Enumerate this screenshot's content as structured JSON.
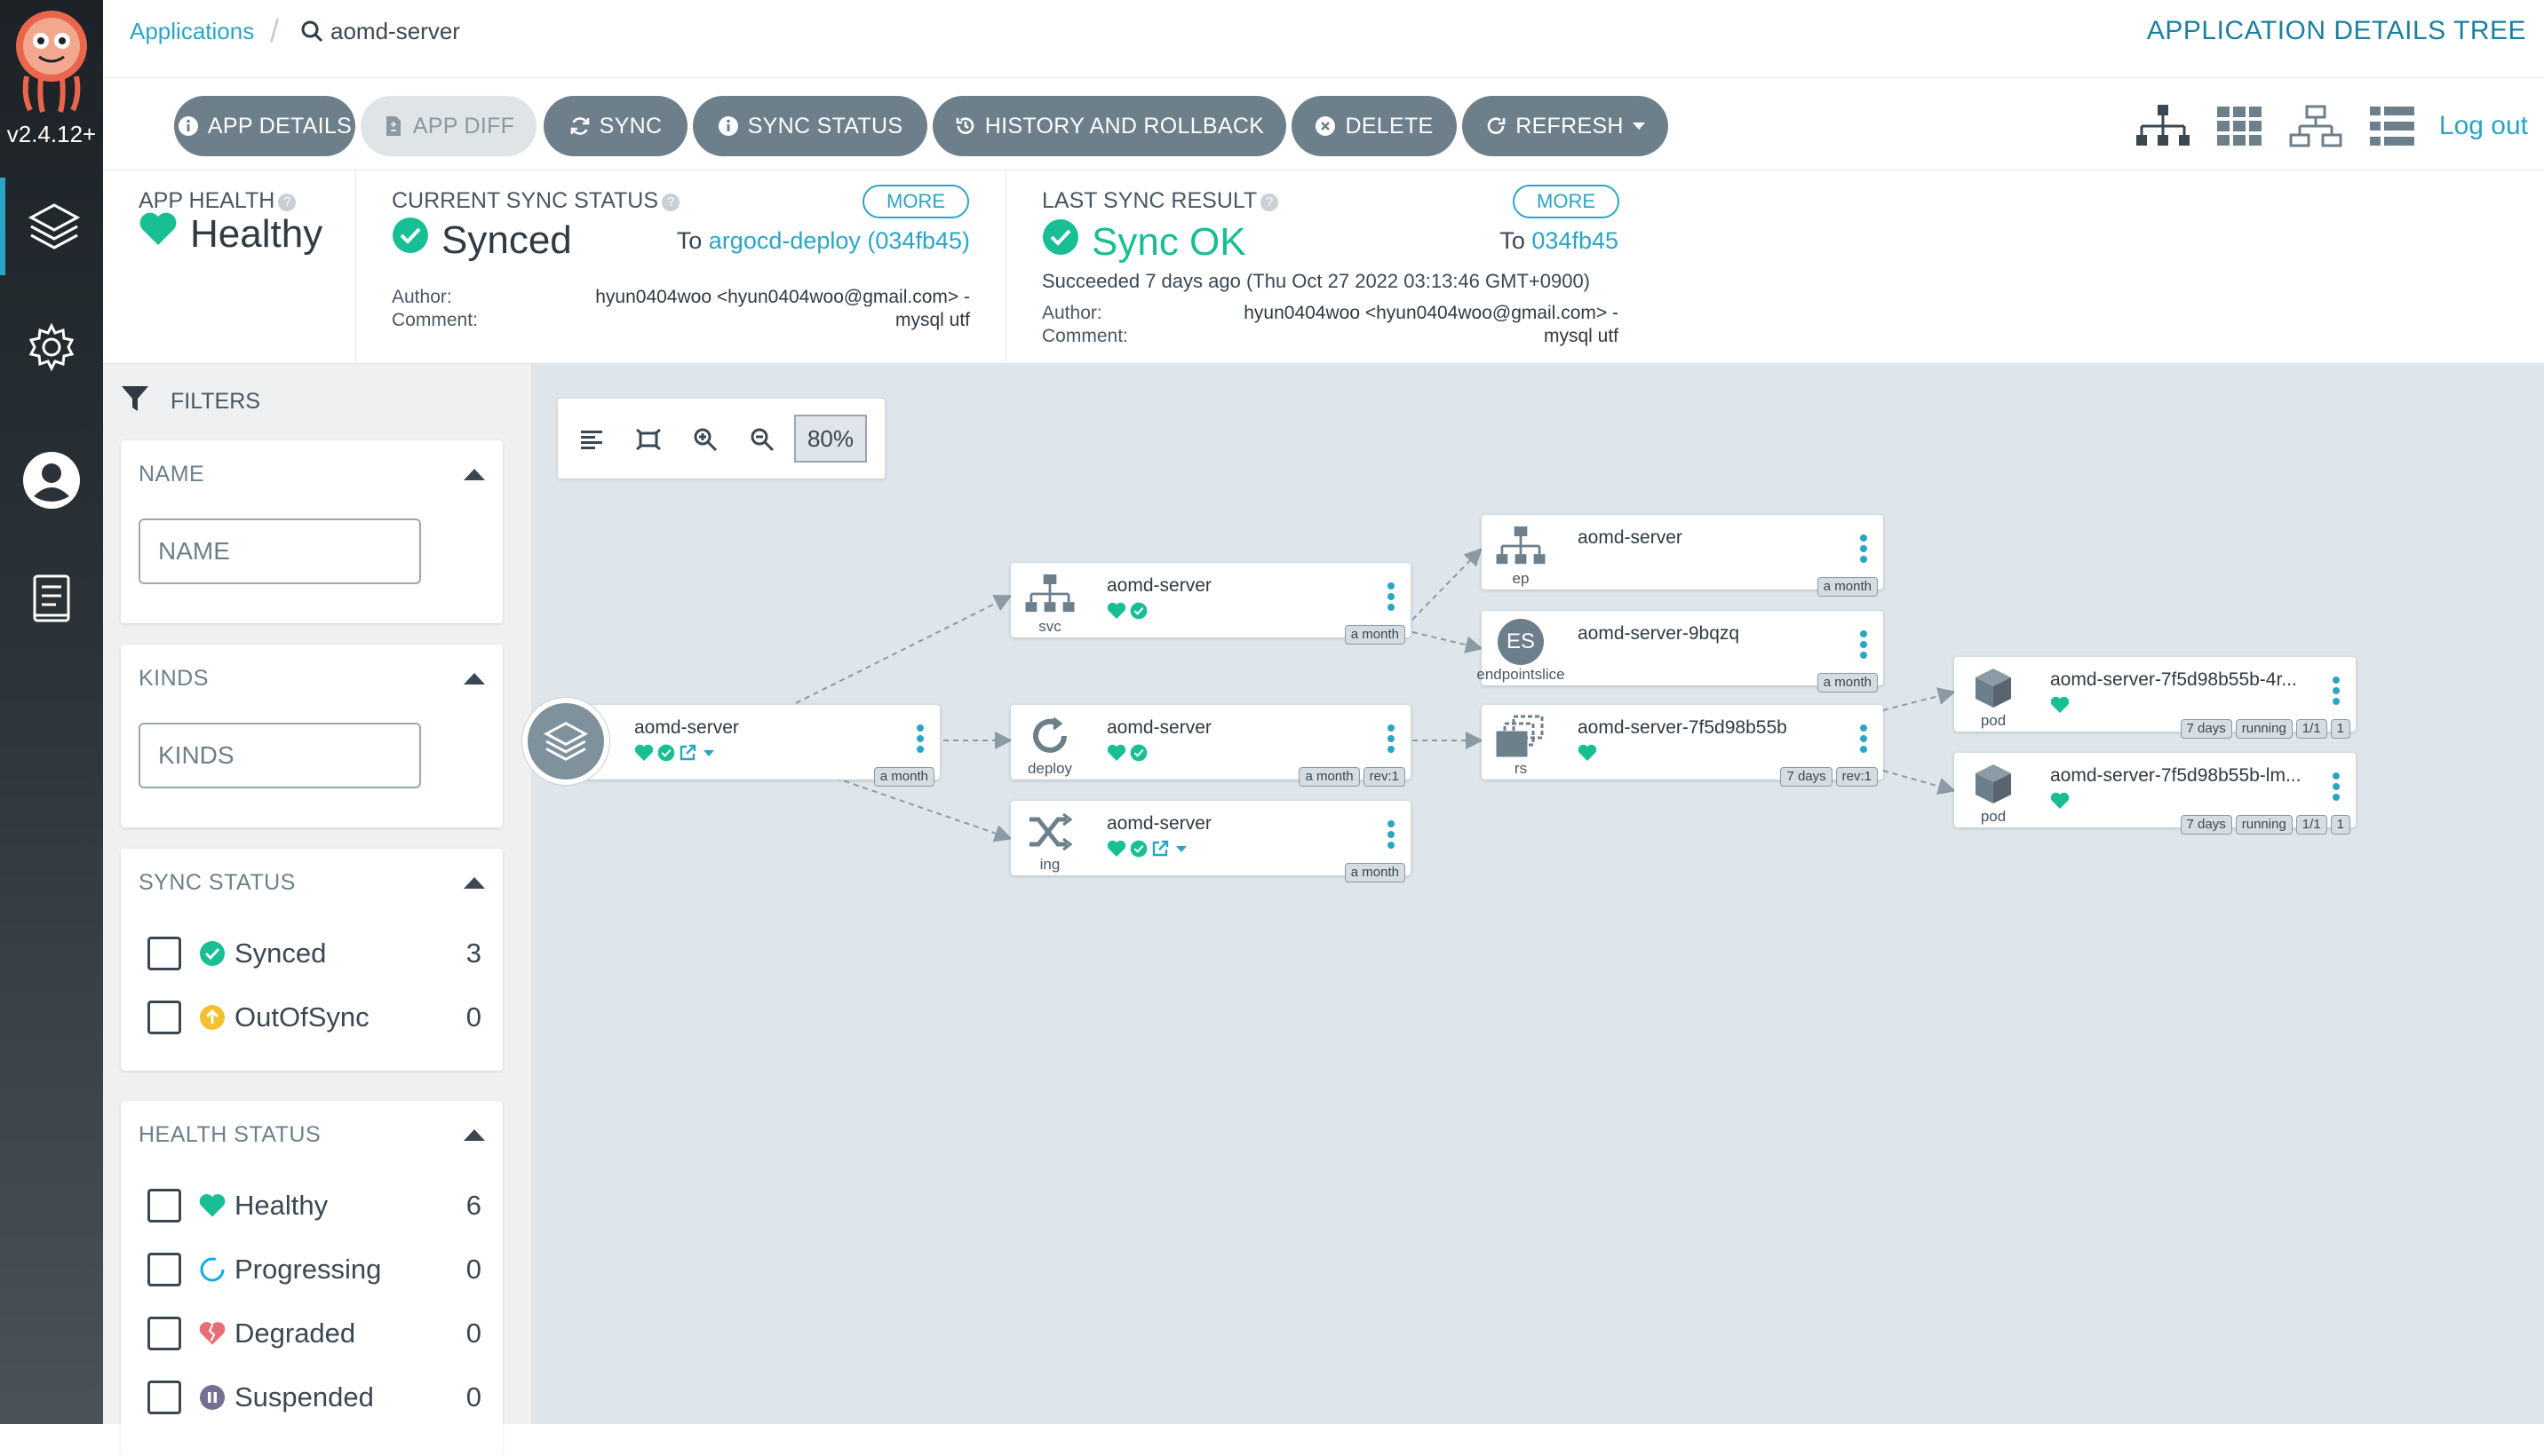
{
  "nav": {
    "version": "v2.4.12+",
    "items": [
      "layers-icon",
      "gear-icon",
      "user-icon",
      "docs-icon"
    ]
  },
  "breadcrumb": {
    "root": "Applications",
    "current": "aomd-server"
  },
  "page_title": "APPLICATION DETAILS TREE",
  "toolbar": {
    "app_details": "APP DETAILS",
    "app_diff": "APP DIFF",
    "sync": "SYNC",
    "sync_status": "SYNC STATUS",
    "history": "HISTORY AND ROLLBACK",
    "delete": "DELETE",
    "refresh": "REFRESH",
    "logout": "Log out"
  },
  "status": {
    "app_health": {
      "title": "APP HEALTH",
      "value": "Healthy"
    },
    "current_sync": {
      "title": "CURRENT SYNC STATUS",
      "value": "Synced",
      "more": "MORE",
      "to_prefix": "To",
      "to_link": "argocd-deploy (034fb45)",
      "author_label": "Author:",
      "comment_label": "Comment:",
      "author_value": "hyun0404woo <hyun0404woo@gmail.com> -",
      "comment_value": "mysql utf"
    },
    "last_sync": {
      "title": "LAST SYNC RESULT",
      "value": "Sync OK",
      "more": "MORE",
      "to_prefix": "To",
      "to_link": "034fb45",
      "succeeded": "Succeeded 7 days ago (Thu Oct 27 2022 03:13:46 GMT+0900)",
      "author_label": "Author:",
      "comment_label": "Comment:",
      "author_value": "hyun0404woo <hyun0404woo@gmail.com> -",
      "comment_value": "mysql utf"
    }
  },
  "filters": {
    "heading": "FILTERS",
    "name": {
      "title": "NAME",
      "placeholder": "NAME"
    },
    "kinds": {
      "title": "KINDS",
      "placeholder": "KINDS"
    },
    "sync_status": {
      "title": "SYNC STATUS",
      "items": [
        {
          "label": "Synced",
          "count": "3"
        },
        {
          "label": "OutOfSync",
          "count": "0"
        }
      ]
    },
    "health_status": {
      "title": "HEALTH STATUS",
      "items": [
        {
          "label": "Healthy",
          "count": "6"
        },
        {
          "label": "Progressing",
          "count": "0"
        },
        {
          "label": "Degraded",
          "count": "0"
        },
        {
          "label": "Suspended",
          "count": "0"
        }
      ]
    }
  },
  "zoom": {
    "value": "80%"
  },
  "nodes": {
    "app": {
      "name": "aomd-server",
      "age": "a month"
    },
    "svc": {
      "name": "aomd-server",
      "kind": "svc",
      "age": "a month"
    },
    "deploy": {
      "name": "aomd-server",
      "kind": "deploy",
      "age": "a month",
      "rev": "rev:1"
    },
    "ing": {
      "name": "aomd-server",
      "kind": "ing",
      "age": "a month"
    },
    "ep": {
      "name": "aomd-server",
      "kind": "ep",
      "age": "a month"
    },
    "eps": {
      "name": "aomd-server-9bqzq",
      "kind": "endpointslice",
      "badge": "ES",
      "age": "a month"
    },
    "rs": {
      "name": "aomd-server-7f5d98b55b",
      "kind": "rs",
      "age": "7 days",
      "rev": "rev:1"
    },
    "pod1": {
      "name": "aomd-server-7f5d98b55b-4r...",
      "kind": "pod",
      "age": "7 days",
      "state": "running",
      "ready": "1/1",
      "restarts": "1"
    },
    "pod2": {
      "name": "aomd-server-7f5d98b55b-lm...",
      "kind": "pod",
      "age": "7 days",
      "state": "running",
      "ready": "1/1",
      "restarts": "1"
    }
  },
  "colors": {
    "accent": "#2aa5c4",
    "healthy": "#18be94",
    "button": "#6d7f8b",
    "out_of_sync": "#f4c030",
    "degraded": "#e96d76",
    "suspended": "#766f94"
  }
}
